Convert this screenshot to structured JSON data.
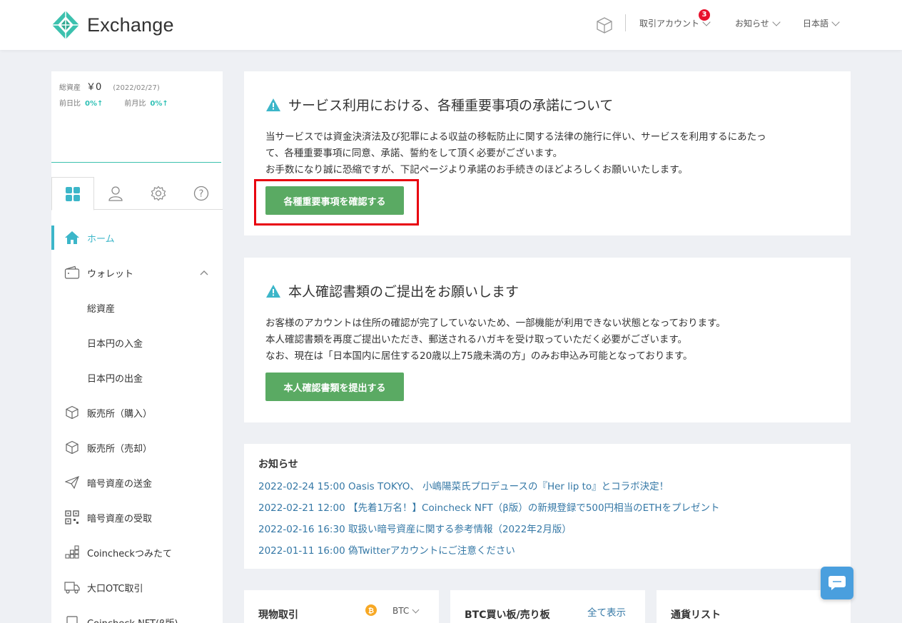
{
  "header": {
    "logo_text": "Exchange",
    "menu_account": "取引アカウント",
    "account_badge": "3",
    "menu_news": "お知らせ",
    "menu_lang": "日本語"
  },
  "sidebar": {
    "total_assets_label": "総資産",
    "total_assets_value": "￥0",
    "total_assets_date": "(2022/02/27)",
    "day_change_label": "前日比",
    "day_change_value": "0%↑",
    "month_change_label": "前月比",
    "month_change_value": "0%↑",
    "items": [
      {
        "label": "ホーム"
      },
      {
        "label": "ウォレット"
      },
      {
        "label": "総資産"
      },
      {
        "label": "日本円の入金"
      },
      {
        "label": "日本円の出金"
      },
      {
        "label": "販売所（購入）"
      },
      {
        "label": "販売所（売却）"
      },
      {
        "label": "暗号資産の送金"
      },
      {
        "label": "暗号資産の受取"
      },
      {
        "label": "Coincheckつみたて"
      },
      {
        "label": "大口OTC取引"
      },
      {
        "label": "Coincheck NFT(β版)"
      }
    ]
  },
  "notice1": {
    "title": "サービス利用における、各種重要事項の承諾について",
    "line1": "当サービスでは資金決済法及び犯罪による収益の移転防止に関する法律の施行に伴い、サービスを利用するにあたっ",
    "line2": "て、各種重要事項に同意、承諾、誓約をして頂く必要がございます。",
    "line3": "お手数になり誠に恐縮ですが、下記ページより承諾のお手続きのほどよろしくお願いいたします。",
    "button": "各種重要事項を確認する"
  },
  "notice2": {
    "title": "本人確認書類のご提出をお願いします",
    "line1": "お客様のアカウントは住所の確認が完了していないため、一部機能が利用できない状態となっております。",
    "line2": "本人確認書類を再度ご提出いただき、郵送されるハガキを受け取っていただく必要がございます。",
    "line3": "なお、現在は「日本国内に居住する20歳以上75歳未満の方」のみお申込み可能となっております。",
    "button": "本人確認書類を提出する"
  },
  "news": {
    "title": "お知らせ",
    "items": [
      "2022-02-24 15:00 Oasis TOKYO、 小嶋陽菜氏プロデュースの『Her lip to』とコラボ決定！",
      "2022-02-21 12:00 【先着1万名！】Coincheck NFT（β版）の新規登録で500円相当のETHをプレゼント",
      "2022-02-16 16:30 取扱い暗号資産に関する参考情報（2022年2月版）",
      "2022-01-11 16:00 偽Twitterアカウントにご注意ください"
    ]
  },
  "bottom": {
    "spot_title": "現物取引",
    "spot_coin": "BTC",
    "board_title": "BTC買い板/売り板",
    "board_link": "全て表示",
    "currency_title": "通貨リスト"
  },
  "colors": {
    "accent": "#3cb6c9",
    "button": "#5aaa63",
    "link": "#3578a6",
    "highlight": "#e8000f"
  }
}
